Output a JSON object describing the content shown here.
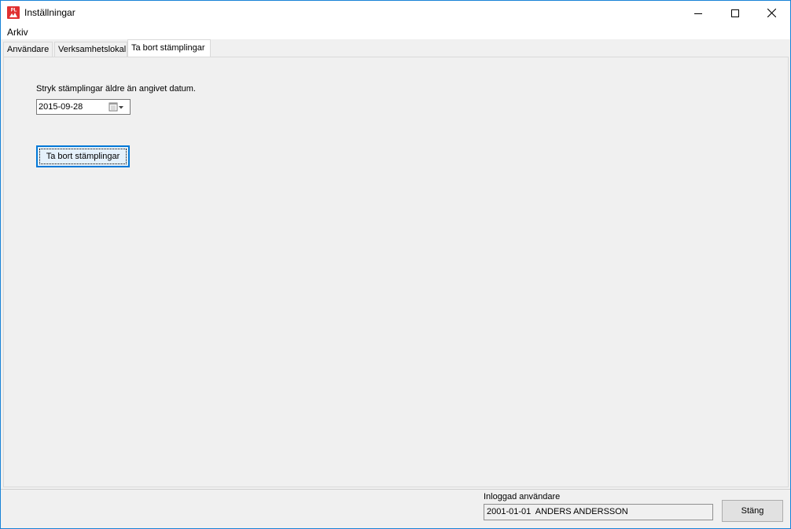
{
  "window": {
    "title": "Inställningar",
    "app_icon": "pl-app-icon",
    "controls": [
      "minimize-icon",
      "maximize-icon",
      "close-icon"
    ]
  },
  "menu": {
    "items": [
      {
        "label": "Arkiv"
      }
    ]
  },
  "tabs": [
    {
      "label": "Användare",
      "active": false
    },
    {
      "label": "Verksamhetslokal",
      "active": false
    },
    {
      "label": "Ta bort stämplingar",
      "active": true
    }
  ],
  "content": {
    "description": "Stryk stämplingar äldre än angivet datum.",
    "date": {
      "value": "2015-09-28",
      "icon": "calendar-icon"
    },
    "delete_button_label": "Ta bort stämplingar"
  },
  "footer": {
    "logged_in_label": "Inloggad användare",
    "logged_in_value": "2001-01-01  ANDERS ANDERSSON",
    "close_button_label": "Stäng"
  },
  "colors": {
    "window_border": "#1883d7",
    "focus_accent": "#0078d7",
    "icon_red": "#e03030"
  }
}
